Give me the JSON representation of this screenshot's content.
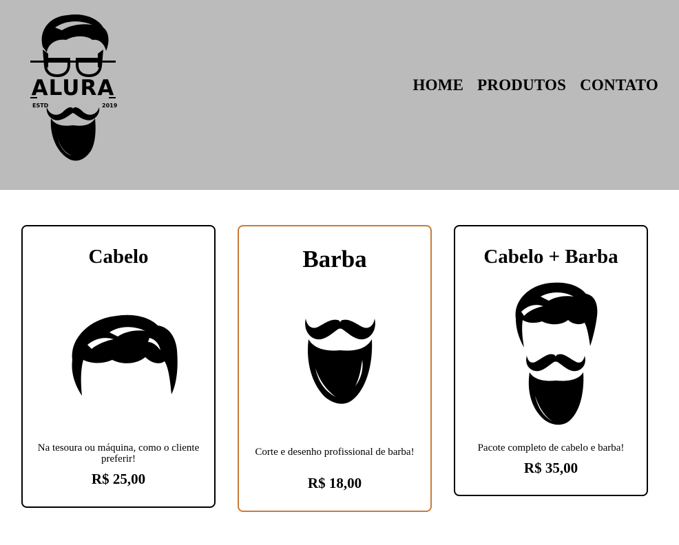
{
  "header": {
    "logo": {
      "text": "ALURA",
      "estd": "ESTD",
      "year": "2019"
    },
    "nav": [
      {
        "label": "HOME"
      },
      {
        "label": "PRODUTOS"
      },
      {
        "label": "CONTATO"
      }
    ]
  },
  "products": [
    {
      "title": "Cabelo",
      "image": "hair-icon",
      "description": "Na tesoura ou máquina, como o cliente preferir!",
      "price": "R$ 25,00"
    },
    {
      "title": "Barba",
      "image": "beard-icon",
      "description": "Corte e desenho profissional de barba!",
      "price": "R$ 18,00"
    },
    {
      "title": "Cabelo + Barba",
      "image": "hair-beard-icon",
      "description": "Pacote completo de cabelo e barba!",
      "price": "R$ 35,00"
    }
  ],
  "colors": {
    "header_bg": "#bbbbbb",
    "card_border": "#000000",
    "highlight_border": "#c97a36"
  }
}
